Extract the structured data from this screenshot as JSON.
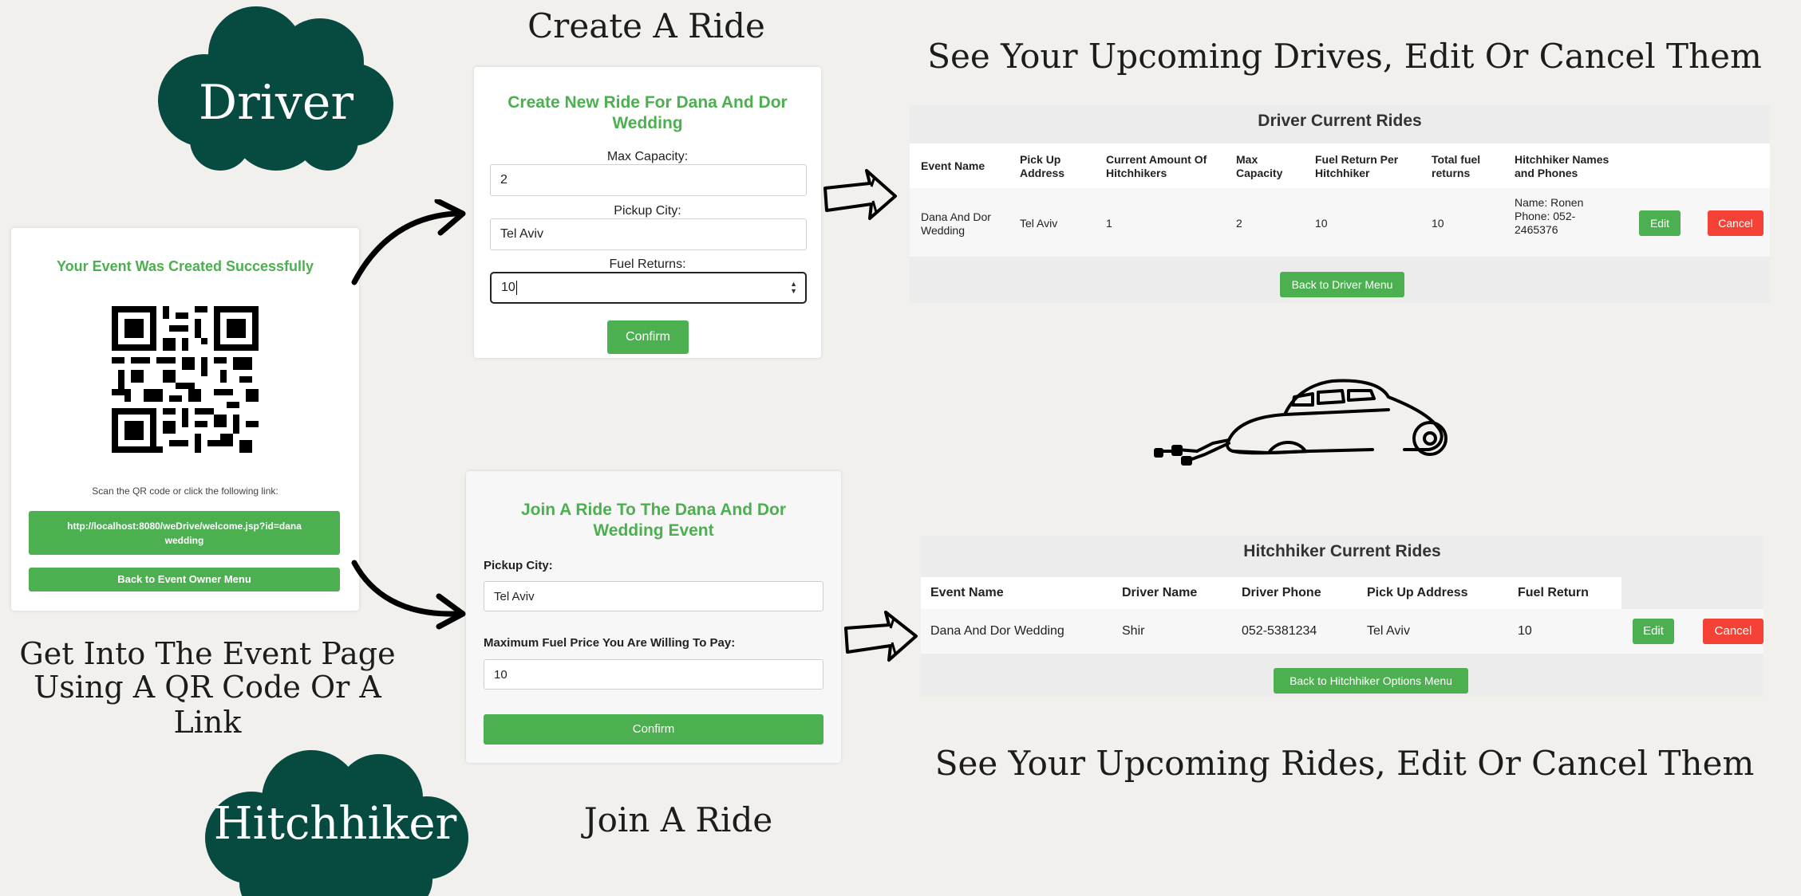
{
  "headings": {
    "create_ride": "Create A Ride",
    "upcoming_drives": "See Your Upcoming Drives, Edit Or Cancel Them",
    "event_page_line1": "Get Into The Event Page",
    "event_page_line2": "Using A QR Code Or A Link",
    "join_ride": "Join A Ride",
    "upcoming_rides": "See Your Upcoming Rides, Edit Or Cancel Them"
  },
  "clouds": {
    "driver": "Driver",
    "hitchhiker": "Hitchhiker"
  },
  "colors": {
    "cloud": "#064a40",
    "green": "#4caf50",
    "red": "#f44336",
    "background": "#f1f0ed"
  },
  "event_card": {
    "title": "Your Event Was Created Successfully",
    "scan_text": "Scan the QR code or click the following link:",
    "link_text": "http://localhost:8080/weDrive/welcome.jsp?id=dana wedding",
    "back_button": "Back to Event Owner Menu"
  },
  "create_ride_form": {
    "title": "Create New Ride For Dana And Dor Wedding",
    "max_capacity_label": "Max Capacity:",
    "max_capacity_value": "2",
    "pickup_city_label": "Pickup City:",
    "pickup_city_value": "Tel Aviv",
    "fuel_returns_label": "Fuel Returns:",
    "fuel_returns_value": "10",
    "confirm_button": "Confirm"
  },
  "join_ride_form": {
    "title": "Join A Ride To The Dana And Dor Wedding Event",
    "pickup_city_label": "Pickup City:",
    "pickup_city_value": "Tel Aviv",
    "max_fuel_label": "Maximum Fuel Price You Are Willing To Pay:",
    "max_fuel_value": "10",
    "confirm_button": "Confirm"
  },
  "driver_rides": {
    "title": "Driver Current Rides",
    "headers": [
      "Event Name",
      "Pick Up Address",
      "Current Amount Of Hitchhikers",
      "Max Capacity",
      "Fuel Return Per Hitchhiker",
      "Total fuel returns",
      "Hitchhiker Names and Phones"
    ],
    "row": {
      "event_name": "Dana And Dor Wedding",
      "pickup": "Tel Aviv",
      "current_amount": "1",
      "max_capacity": "2",
      "fuel_per": "10",
      "total_fuel": "10",
      "hitchhikers": "Name: Ronen Phone: 052-2465376"
    },
    "edit_button": "Edit",
    "cancel_button": "Cancel",
    "back_button": "Back to Driver Menu"
  },
  "hitchhiker_rides": {
    "title": "Hitchhiker Current Rides",
    "headers": [
      "Event Name",
      "Driver Name",
      "Driver Phone",
      "Pick Up Address",
      "Fuel Return"
    ],
    "row": {
      "event_name": "Dana And Dor Wedding",
      "driver_name": "Shir",
      "driver_phone": "052-5381234",
      "pickup": "Tel Aviv",
      "fuel_return": "10"
    },
    "edit_button": "Edit",
    "cancel_button": "Cancel",
    "back_button": "Back to Hitchhiker Options Menu"
  },
  "icons": [
    "qr-code-icon",
    "curved-arrow-icon",
    "hand-drawn-arrow-icon",
    "wedding-car-icon",
    "number-spinner-icon"
  ]
}
